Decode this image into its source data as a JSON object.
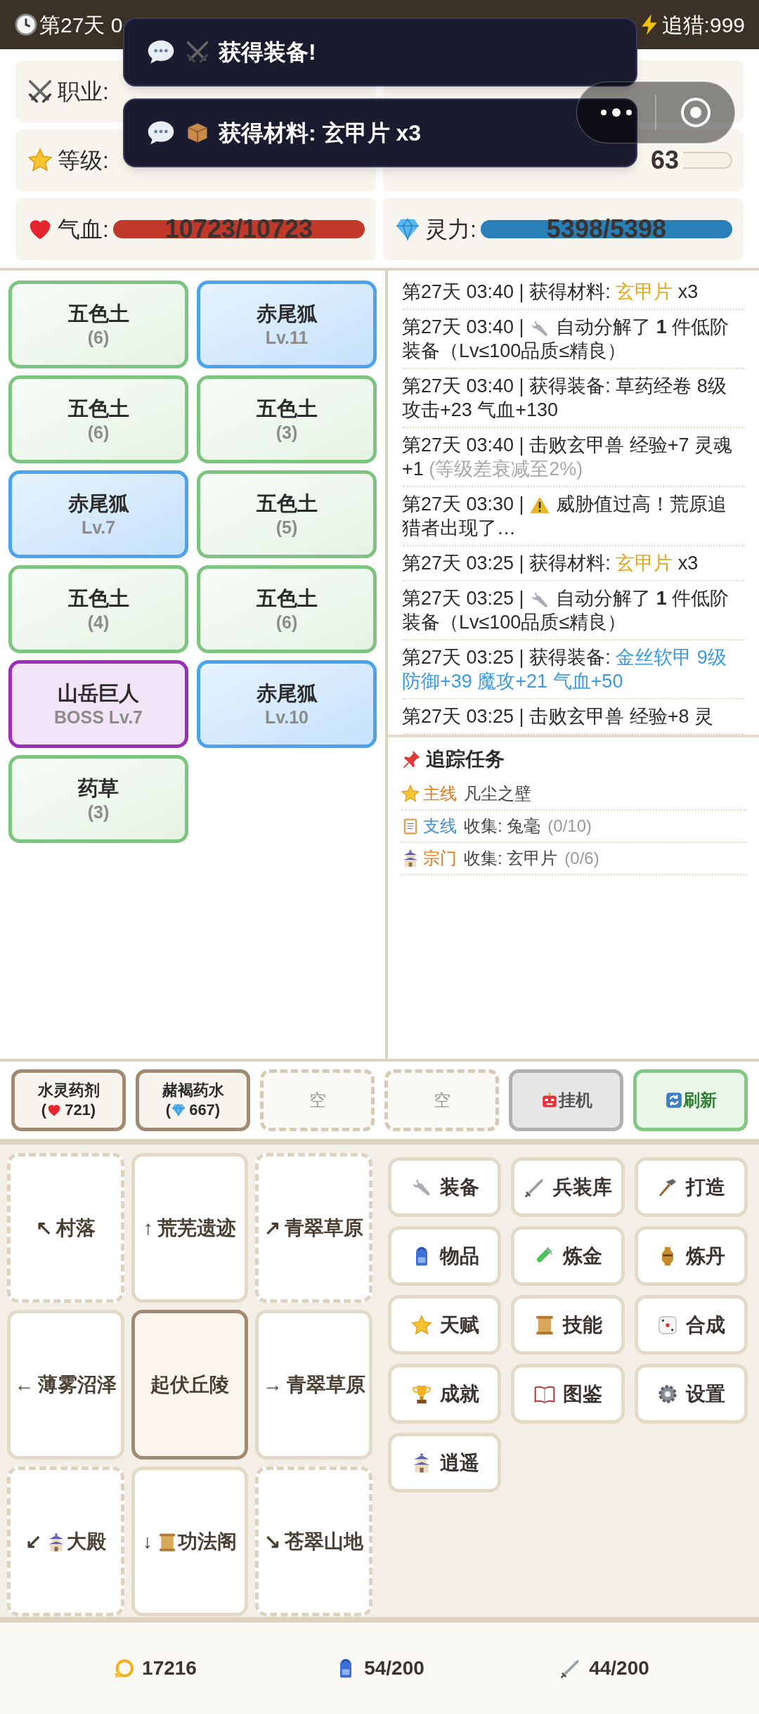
{
  "top_bar": {
    "day": "第27天 0",
    "chase": "追猎:999"
  },
  "toasts": [
    {
      "kind": "gear",
      "text": "获得装备!"
    },
    {
      "kind": "material",
      "text": "获得材料: 玄甲片 x3"
    }
  ],
  "stats": [
    {
      "kind": "class",
      "label": "职业:"
    },
    {
      "kind": "blank"
    },
    {
      "kind": "level",
      "label": "等级:"
    },
    {
      "kind": "exp",
      "reading": "63"
    },
    {
      "kind": "hp",
      "label": "气血:",
      "reading": "10723/10723",
      "level": 1
    },
    {
      "kind": "mp",
      "label": "灵力:",
      "reading": "5398/5398",
      "level": 1
    }
  ],
  "map_cards": [
    {
      "kind": "resource",
      "name": "五色土",
      "sub": "(6)"
    },
    {
      "kind": "monster",
      "name": "赤尾狐",
      "sub": "Lv.11"
    },
    {
      "kind": "resource",
      "name": "五色土",
      "sub": "(6)"
    },
    {
      "kind": "resource",
      "name": "五色土",
      "sub": "(3)"
    },
    {
      "kind": "monster",
      "name": "赤尾狐",
      "sub": "Lv.7"
    },
    {
      "kind": "resource",
      "name": "五色土",
      "sub": "(5)"
    },
    {
      "kind": "resource",
      "name": "五色土",
      "sub": "(4)"
    },
    {
      "kind": "resource",
      "name": "五色土",
      "sub": "(6)"
    },
    {
      "kind": "boss",
      "name": "山岳巨人",
      "sub": "BOSS Lv.7"
    },
    {
      "kind": "monster",
      "name": "赤尾狐",
      "sub": "Lv.10"
    },
    {
      "kind": "resource",
      "name": "药草",
      "sub": "(3)"
    }
  ],
  "log": [
    {
      "kind": "plain",
      "time": "第27天 03:40 |",
      "parts": [
        {
          "kind": "plain",
          "text": "获得材料: "
        },
        {
          "kind": "gold",
          "text": "玄甲片"
        },
        {
          "kind": "plain",
          "text": " x3"
        }
      ]
    },
    {
      "kind": "salvage",
      "time": "第27天 03:40 |",
      "parts": [
        {
          "kind": "plain",
          "text": "自动分解了 **1** 件低阶装备（Lv≤100品质≤精良）"
        }
      ]
    },
    {
      "kind": "plain",
      "time": "第27天 03:40 |",
      "parts": [
        {
          "kind": "plain",
          "text": "获得装备: 草药经卷 8级攻击+23 气血+130"
        }
      ]
    },
    {
      "kind": "plain",
      "time": "第27天 03:40 |",
      "parts": [
        {
          "kind": "plain",
          "text": "击败玄甲兽 经验+7 灵魂+1 "
        },
        {
          "kind": "muted",
          "text": "(等级差衰减至2%)"
        }
      ]
    },
    {
      "kind": "alert",
      "time": "第27天 03:30 |",
      "parts": [
        {
          "kind": "plain",
          "text": "威胁值过高！荒原追猎者出现了…"
        }
      ]
    },
    {
      "kind": "plain",
      "time": "第27天 03:25 |",
      "parts": [
        {
          "kind": "plain",
          "text": "获得材料: "
        },
        {
          "kind": "gold",
          "text": "玄甲片"
        },
        {
          "kind": "plain",
          "text": " x3"
        }
      ]
    },
    {
      "kind": "salvage",
      "time": "第27天 03:25 |",
      "parts": [
        {
          "kind": "plain",
          "text": "自动分解了 **1** 件低阶装备（Lv≤100品质≤精良）"
        }
      ]
    },
    {
      "kind": "plain",
      "time": "第27天 03:25 |",
      "parts": [
        {
          "kind": "plain",
          "text": "获得装备: "
        },
        {
          "kind": "blue",
          "text": "金丝软甲 9级防御+39 魔攻+21 气血+50"
        }
      ]
    },
    {
      "kind": "plain",
      "time": "第27天 03:25 |",
      "parts": [
        {
          "kind": "plain",
          "text": "击败玄甲兽 经验+8 灵"
        }
      ]
    }
  ],
  "quests": {
    "title": "追踪任务",
    "items": [
      {
        "kind": "main",
        "tag": "主线",
        "text": "凡尘之壁"
      },
      {
        "kind": "side",
        "tag": "支线",
        "text": "收集: 兔毫",
        "progress": "(0/10)"
      },
      {
        "kind": "sect",
        "tag": "宗门",
        "text": "收集: 玄甲片",
        "progress": "(0/6)"
      }
    ]
  },
  "action_bar": [
    {
      "kind": "hp_potion",
      "name": "水灵药剂",
      "open": "(",
      "value": "721)"
    },
    {
      "kind": "mp_potion",
      "name": "赭褐药水",
      "open": "(",
      "value": "667)"
    },
    {
      "kind": "empty",
      "name": "空"
    },
    {
      "kind": "empty",
      "name": "空"
    },
    {
      "kind": "idle",
      "name": "挂机"
    },
    {
      "kind": "refresh",
      "name": "刷新"
    }
  ],
  "nav": [
    {
      "arrow": "↖",
      "label": "村落",
      "kind": "unexplored"
    },
    {
      "arrow": "↑",
      "label": "荒芜遗迹",
      "kind": "explored"
    },
    {
      "arrow": "↗",
      "label": "青翠草原",
      "kind": "unexplored"
    },
    {
      "arrow": "←",
      "label": "薄雾沼泽",
      "kind": "explored"
    },
    {
      "label": "起伏丘陵",
      "kind": "current"
    },
    {
      "arrow": "→",
      "label": "青翠草原",
      "kind": "explored"
    },
    {
      "arrow": "↙",
      "label": "大殿",
      "kind": "unexplored",
      "building": {
        "kind": "hall"
      }
    },
    {
      "arrow": "↓",
      "label": "功法阁",
      "kind": "explored",
      "building": {
        "kind": "library"
      }
    },
    {
      "arrow": "↘",
      "label": "苍翠山地",
      "kind": "unexplored"
    }
  ],
  "menu": [
    {
      "kind": "equip",
      "label": "装备"
    },
    {
      "kind": "armory",
      "label": "兵装库"
    },
    {
      "kind": "forge",
      "label": "打造"
    },
    {
      "kind": "items",
      "label": "物品"
    },
    {
      "kind": "alchemy",
      "label": "炼金"
    },
    {
      "kind": "elixir",
      "label": "炼丹"
    },
    {
      "kind": "talent",
      "label": "天赋"
    },
    {
      "kind": "skill",
      "label": "技能"
    },
    {
      "kind": "craft",
      "label": "合成"
    },
    {
      "kind": "achieve",
      "label": "成就"
    },
    {
      "kind": "codex",
      "label": "图鉴"
    },
    {
      "kind": "settings",
      "label": "设置"
    },
    {
      "kind": "roam",
      "label": "逍遥"
    }
  ],
  "footer": [
    {
      "kind": "gold",
      "text": "17216"
    },
    {
      "kind": "bag",
      "text": "54/200"
    },
    {
      "kind": "armory",
      "text": "44/200"
    }
  ]
}
